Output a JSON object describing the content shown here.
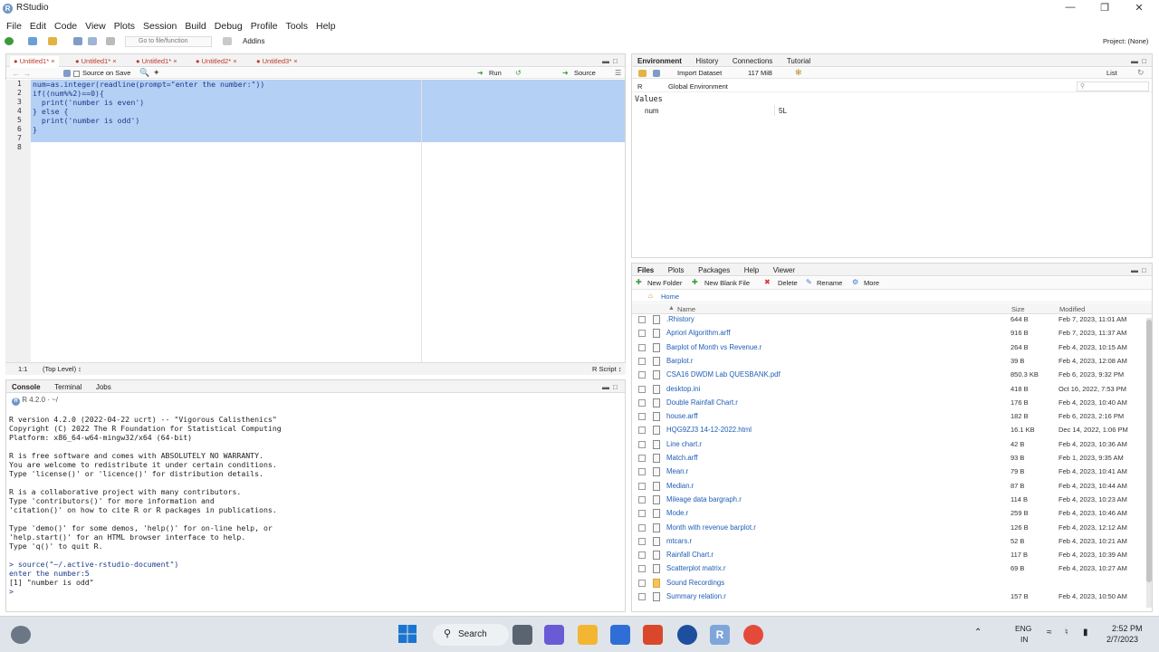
{
  "window": {
    "title": "RStudio"
  },
  "menu": [
    "File",
    "Edit",
    "Code",
    "View",
    "Plots",
    "Session",
    "Build",
    "Debug",
    "Profile",
    "Tools",
    "Help"
  ],
  "toolbar": {
    "goto_placeholder": "Go to file/function",
    "addins": "Addins",
    "project": "Project: (None)"
  },
  "editor": {
    "tabs": [
      "Untitled1*",
      "Untitled1*",
      "Untitled1*",
      "Untitled2*",
      "Untitled3*"
    ],
    "source_on_save": "Source on Save",
    "run": "Run",
    "source": "Source",
    "line_numbers": [
      "1",
      "2",
      "3",
      "4",
      "5",
      "6",
      "7",
      "8"
    ],
    "lines": [
      "num=as.integer(readline(prompt=\"enter the number:\"))",
      "if((num%%2)==0){",
      "  print('number is even')",
      "} else {",
      "  print('number is odd')",
      "}",
      "",
      ""
    ],
    "status_pos": "1:1",
    "status_level": "(Top Level) ↕",
    "status_type": "R Script ↕"
  },
  "console": {
    "tabs": [
      "Console",
      "Terminal",
      "Jobs"
    ],
    "version_label": "R 4.2.0 · ~/",
    "lines": [
      "R version 4.2.0 (2022-04-22 ucrt) -- \"Vigorous Calisthenics\"",
      "Copyright (C) 2022 The R Foundation for Statistical Computing",
      "Platform: x86_64-w64-mingw32/x64 (64-bit)",
      "",
      "R is free software and comes with ABSOLUTELY NO WARRANTY.",
      "You are welcome to redistribute it under certain conditions.",
      "Type 'license()' or 'licence()' for distribution details.",
      "",
      "R is a collaborative project with many contributors.",
      "Type 'contributors()' for more information and",
      "'citation()' on how to cite R or R packages in publications.",
      "",
      "Type 'demo()' for some demos, 'help()' for on-line help, or",
      "'help.start()' for an HTML browser interface to help.",
      "Type 'q()' to quit R.",
      "",
      "> source(\"~/.active-rstudio-document\")",
      "enter the number:5",
      "[1] \"number is odd\"",
      "> "
    ]
  },
  "environment": {
    "tabs": [
      "Environment",
      "History",
      "Connections",
      "Tutorial"
    ],
    "import_dataset": "Import Dataset",
    "memory": "117 MiB",
    "list_label": "List",
    "lang": "R",
    "scope": "Global Environment",
    "section": "Values",
    "vars": [
      {
        "name": "num",
        "value": "5L"
      }
    ]
  },
  "files": {
    "tabs": [
      "Files",
      "Plots",
      "Packages",
      "Help",
      "Viewer"
    ],
    "new_folder": "New Folder",
    "new_blank_file": "New Blank File",
    "delete": "Delete",
    "rename": "Rename",
    "more": "More",
    "home": "Home",
    "col_name": "Name",
    "col_size": "Size",
    "col_modified": "Modified",
    "rows": [
      {
        "name": ".Rhistory",
        "size": "644 B",
        "modified": "Feb 7, 2023, 11:01 AM"
      },
      {
        "name": "Apriori Algorithm.arff",
        "size": "916 B",
        "modified": "Feb 7, 2023, 11:37 AM"
      },
      {
        "name": "Barplot of Month vs Revenue.r",
        "size": "264 B",
        "modified": "Feb 4, 2023, 10:15 AM"
      },
      {
        "name": "Barplot.r",
        "size": "39 B",
        "modified": "Feb 4, 2023, 12:08 AM"
      },
      {
        "name": "CSA16 DWDM Lab QUESBANK.pdf",
        "size": "850.3 KB",
        "modified": "Feb 6, 2023, 9:32 PM"
      },
      {
        "name": "desktop.ini",
        "size": "418 B",
        "modified": "Oct 16, 2022, 7:53 PM"
      },
      {
        "name": "Double Rainfall Chart.r",
        "size": "176 B",
        "modified": "Feb 4, 2023, 10:40 AM"
      },
      {
        "name": "house.arff",
        "size": "182 B",
        "modified": "Feb 6, 2023, 2:16 PM"
      },
      {
        "name": "HQG9ZJ3 14-12-2022.html",
        "size": "16.1 KB",
        "modified": "Dec 14, 2022, 1:06 PM"
      },
      {
        "name": "Line chart.r",
        "size": "42 B",
        "modified": "Feb 4, 2023, 10:36 AM"
      },
      {
        "name": "Match.arff",
        "size": "93 B",
        "modified": "Feb 1, 2023, 9:35 AM"
      },
      {
        "name": "Mean.r",
        "size": "79 B",
        "modified": "Feb 4, 2023, 10:41 AM"
      },
      {
        "name": "Median.r",
        "size": "87 B",
        "modified": "Feb 4, 2023, 10:44 AM"
      },
      {
        "name": "Mileage data bargraph.r",
        "size": "114 B",
        "modified": "Feb 4, 2023, 10:23 AM"
      },
      {
        "name": "Mode.r",
        "size": "259 B",
        "modified": "Feb 4, 2023, 10:46 AM"
      },
      {
        "name": "Month with revenue barplot.r",
        "size": "126 B",
        "modified": "Feb 4, 2023, 12:12 AM"
      },
      {
        "name": "mtcars.r",
        "size": "52 B",
        "modified": "Feb 4, 2023, 10:21 AM"
      },
      {
        "name": "Rainfall Chart.r",
        "size": "117 B",
        "modified": "Feb 4, 2023, 10:39 AM"
      },
      {
        "name": "Scatterplot matrix.r",
        "size": "69 B",
        "modified": "Feb 4, 2023, 10:27 AM"
      },
      {
        "name": "Sound Recordings",
        "size": "",
        "modified": ""
      },
      {
        "name": "Summary relation.r",
        "size": "157 B",
        "modified": "Feb 4, 2023, 10:50 AM"
      }
    ]
  },
  "taskbar": {
    "search": "Search",
    "lang1": "ENG",
    "lang2": "IN",
    "time": "2:52 PM",
    "date": "2/7/2023"
  }
}
